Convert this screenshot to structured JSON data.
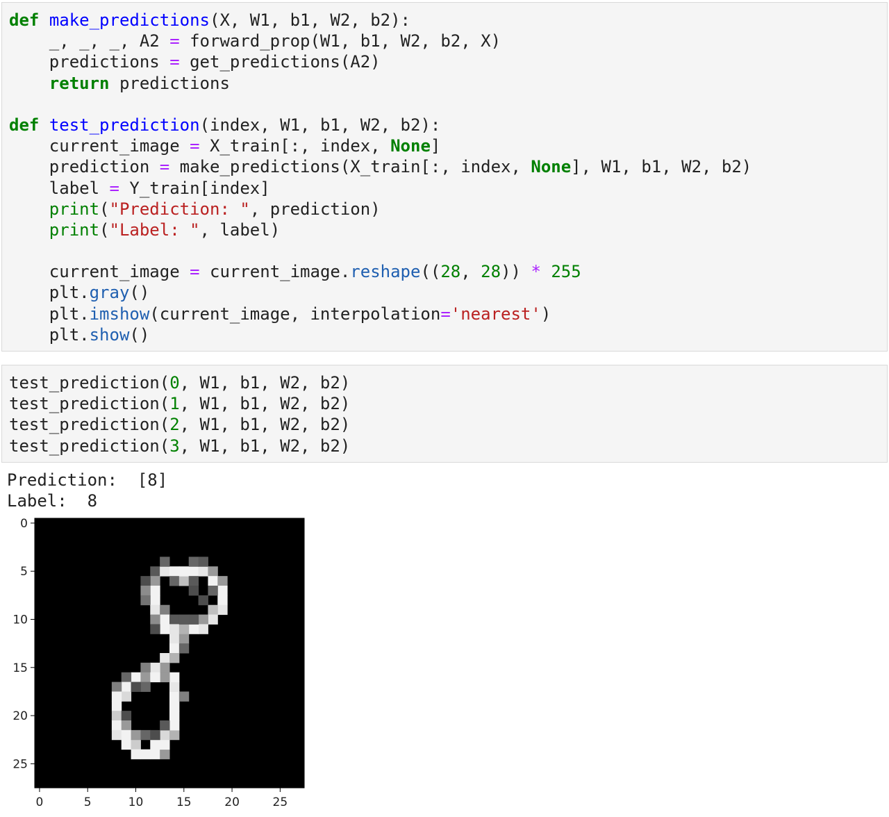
{
  "cell1": {
    "lines": [
      [
        [
          "kw",
          "def"
        ],
        [
          "plain",
          " "
        ],
        [
          "fn",
          "make_predictions"
        ],
        [
          "plain",
          "(X, W1, b1, W2, b2):"
        ]
      ],
      [
        [
          "plain",
          "    _, _, _, A2 "
        ],
        [
          "op",
          "="
        ],
        [
          "plain",
          " forward_prop(W1, b1, W2, b2, X)"
        ]
      ],
      [
        [
          "plain",
          "    predictions "
        ],
        [
          "op",
          "="
        ],
        [
          "plain",
          " get_predictions(A2)"
        ]
      ],
      [
        [
          "plain",
          "    "
        ],
        [
          "kw",
          "return"
        ],
        [
          "plain",
          " predictions"
        ]
      ],
      [],
      [
        [
          "kw",
          "def"
        ],
        [
          "plain",
          " "
        ],
        [
          "fn",
          "test_prediction"
        ],
        [
          "plain",
          "(index, W1, b1, W2, b2):"
        ]
      ],
      [
        [
          "plain",
          "    current_image "
        ],
        [
          "op",
          "="
        ],
        [
          "plain",
          " X_train[:, index, "
        ],
        [
          "kw",
          "None"
        ],
        [
          "plain",
          "]"
        ]
      ],
      [
        [
          "plain",
          "    prediction "
        ],
        [
          "op",
          "="
        ],
        [
          "plain",
          " make_predictions(X_train[:, index, "
        ],
        [
          "kw",
          "None"
        ],
        [
          "plain",
          "], W1, b1, W2, b2)"
        ]
      ],
      [
        [
          "plain",
          "    label "
        ],
        [
          "op",
          "="
        ],
        [
          "plain",
          " Y_train[index]"
        ]
      ],
      [
        [
          "plain",
          "    "
        ],
        [
          "bi",
          "print"
        ],
        [
          "plain",
          "("
        ],
        [
          "str",
          "\"Prediction: \""
        ],
        [
          "plain",
          ", prediction)"
        ]
      ],
      [
        [
          "plain",
          "    "
        ],
        [
          "bi",
          "print"
        ],
        [
          "plain",
          "("
        ],
        [
          "str",
          "\"Label: \""
        ],
        [
          "plain",
          ", label)"
        ]
      ],
      [],
      [
        [
          "plain",
          "    current_image "
        ],
        [
          "op",
          "="
        ],
        [
          "plain",
          " current_image."
        ],
        [
          "attr",
          "reshape"
        ],
        [
          "plain",
          "(("
        ],
        [
          "num",
          "28"
        ],
        [
          "plain",
          ", "
        ],
        [
          "num",
          "28"
        ],
        [
          "plain",
          ")) "
        ],
        [
          "op",
          "*"
        ],
        [
          "plain",
          " "
        ],
        [
          "num",
          "255"
        ]
      ],
      [
        [
          "plain",
          "    plt."
        ],
        [
          "attr",
          "gray"
        ],
        [
          "plain",
          "()"
        ]
      ],
      [
        [
          "plain",
          "    plt."
        ],
        [
          "attr",
          "imshow"
        ],
        [
          "plain",
          "(current_image, interpolation"
        ],
        [
          "op",
          "="
        ],
        [
          "str",
          "'nearest'"
        ],
        [
          "plain",
          ")"
        ]
      ],
      [
        [
          "plain",
          "    plt."
        ],
        [
          "attr",
          "show"
        ],
        [
          "plain",
          "()"
        ]
      ]
    ]
  },
  "cell2": {
    "lines": [
      [
        [
          "plain",
          "test_prediction("
        ],
        [
          "num",
          "0"
        ],
        [
          "plain",
          ", W1, b1, W2, b2)"
        ]
      ],
      [
        [
          "plain",
          "test_prediction("
        ],
        [
          "num",
          "1"
        ],
        [
          "plain",
          ", W1, b1, W2, b2)"
        ]
      ],
      [
        [
          "plain",
          "test_prediction("
        ],
        [
          "num",
          "2"
        ],
        [
          "plain",
          ", W1, b1, W2, b2)"
        ]
      ],
      [
        [
          "plain",
          "test_prediction("
        ],
        [
          "num",
          "3"
        ],
        [
          "plain",
          ", W1, b1, W2, b2)"
        ]
      ]
    ]
  },
  "output": {
    "prediction_text": "Prediction:  [8]",
    "label_text": "Label:  8"
  },
  "chart_data": {
    "type": "heatmap",
    "colormap": "gray",
    "background_color": "#000000",
    "xlim": [
      0,
      27
    ],
    "ylim": [
      27,
      0
    ],
    "xticks": [
      0,
      5,
      10,
      15,
      20,
      25
    ],
    "yticks": [
      0,
      5,
      10,
      15,
      20,
      25
    ],
    "xtick_labels": [
      "0",
      "5",
      "10",
      "15",
      "20",
      "25"
    ],
    "ytick_labels": [
      "0",
      "5",
      "10",
      "15",
      "20",
      "25"
    ],
    "pixels": [
      [
        12,
        5,
        0.35
      ],
      [
        12,
        6,
        0.6
      ],
      [
        11,
        6,
        0.3
      ],
      [
        12,
        7,
        0.95
      ],
      [
        11,
        7,
        0.55
      ],
      [
        12,
        8,
        0.95
      ],
      [
        11,
        8,
        0.45
      ],
      [
        12,
        9,
        0.9
      ],
      [
        13,
        9,
        0.5
      ],
      [
        13,
        10,
        0.95
      ],
      [
        12,
        10,
        0.55
      ],
      [
        14,
        10,
        0.35
      ],
      [
        13,
        11,
        0.95
      ],
      [
        14,
        11,
        0.9
      ],
      [
        12,
        11,
        0.3
      ],
      [
        14,
        12,
        0.9
      ],
      [
        15,
        12,
        0.6
      ],
      [
        14,
        13,
        0.95
      ],
      [
        15,
        13,
        0.4
      ],
      [
        13,
        14,
        0.9
      ],
      [
        14,
        14,
        0.7
      ],
      [
        13,
        15,
        0.6
      ],
      [
        12,
        15,
        0.9
      ],
      [
        11,
        15,
        0.5
      ],
      [
        13,
        5,
        0.9
      ],
      [
        14,
        5,
        0.95
      ],
      [
        13,
        4,
        0.4
      ],
      [
        14,
        6,
        0.4
      ],
      [
        15,
        6,
        0.75
      ],
      [
        15,
        5,
        0.95
      ],
      [
        16,
        5,
        0.95
      ],
      [
        17,
        5,
        0.9
      ],
      [
        16,
        4,
        0.4
      ],
      [
        17,
        4,
        0.35
      ],
      [
        18,
        5,
        0.6
      ],
      [
        18,
        6,
        0.95
      ],
      [
        19,
        6,
        0.6
      ],
      [
        19,
        7,
        0.95
      ],
      [
        19,
        8,
        0.95
      ],
      [
        18,
        7,
        0.4
      ],
      [
        19,
        9,
        0.9
      ],
      [
        18,
        9,
        0.75
      ],
      [
        18,
        10,
        0.9
      ],
      [
        17,
        10,
        0.6
      ],
      [
        17,
        11,
        0.9
      ],
      [
        16,
        11,
        0.95
      ],
      [
        15,
        11,
        0.7
      ],
      [
        16,
        10,
        0.35
      ],
      [
        15,
        10,
        0.35
      ],
      [
        16,
        6,
        0.35
      ],
      [
        16,
        7,
        0.3
      ],
      [
        17,
        8,
        0.3
      ],
      [
        10,
        16,
        0.95
      ],
      [
        11,
        16,
        0.6
      ],
      [
        9,
        16,
        0.4
      ],
      [
        9,
        17,
        0.95
      ],
      [
        8,
        17,
        0.5
      ],
      [
        9,
        18,
        0.85
      ],
      [
        8,
        18,
        0.95
      ],
      [
        8,
        19,
        0.95
      ],
      [
        8,
        20,
        0.8
      ],
      [
        9,
        20,
        0.3
      ],
      [
        8,
        21,
        0.95
      ],
      [
        9,
        21,
        0.6
      ],
      [
        8,
        22,
        0.9
      ],
      [
        9,
        22,
        0.95
      ],
      [
        9,
        23,
        0.95
      ],
      [
        10,
        23,
        0.8
      ],
      [
        10,
        24,
        0.95
      ],
      [
        11,
        24,
        0.95
      ],
      [
        12,
        24,
        0.95
      ],
      [
        13,
        24,
        0.6
      ],
      [
        12,
        23,
        0.95
      ],
      [
        13,
        23,
        0.95
      ],
      [
        13,
        22,
        0.85
      ],
      [
        14,
        22,
        0.7
      ],
      [
        14,
        21,
        0.95
      ],
      [
        14,
        20,
        0.95
      ],
      [
        14,
        19,
        0.95
      ],
      [
        14,
        18,
        0.95
      ],
      [
        15,
        18,
        0.5
      ],
      [
        14,
        17,
        0.9
      ],
      [
        14,
        16,
        0.95
      ],
      [
        13,
        16,
        0.6
      ],
      [
        12,
        16,
        0.95
      ],
      [
        11,
        17,
        0.4
      ],
      [
        10,
        22,
        0.6
      ],
      [
        11,
        22,
        0.4
      ],
      [
        12,
        22,
        0.3
      ],
      [
        13,
        21,
        0.35
      ],
      [
        10,
        17,
        0.3
      ]
    ]
  }
}
